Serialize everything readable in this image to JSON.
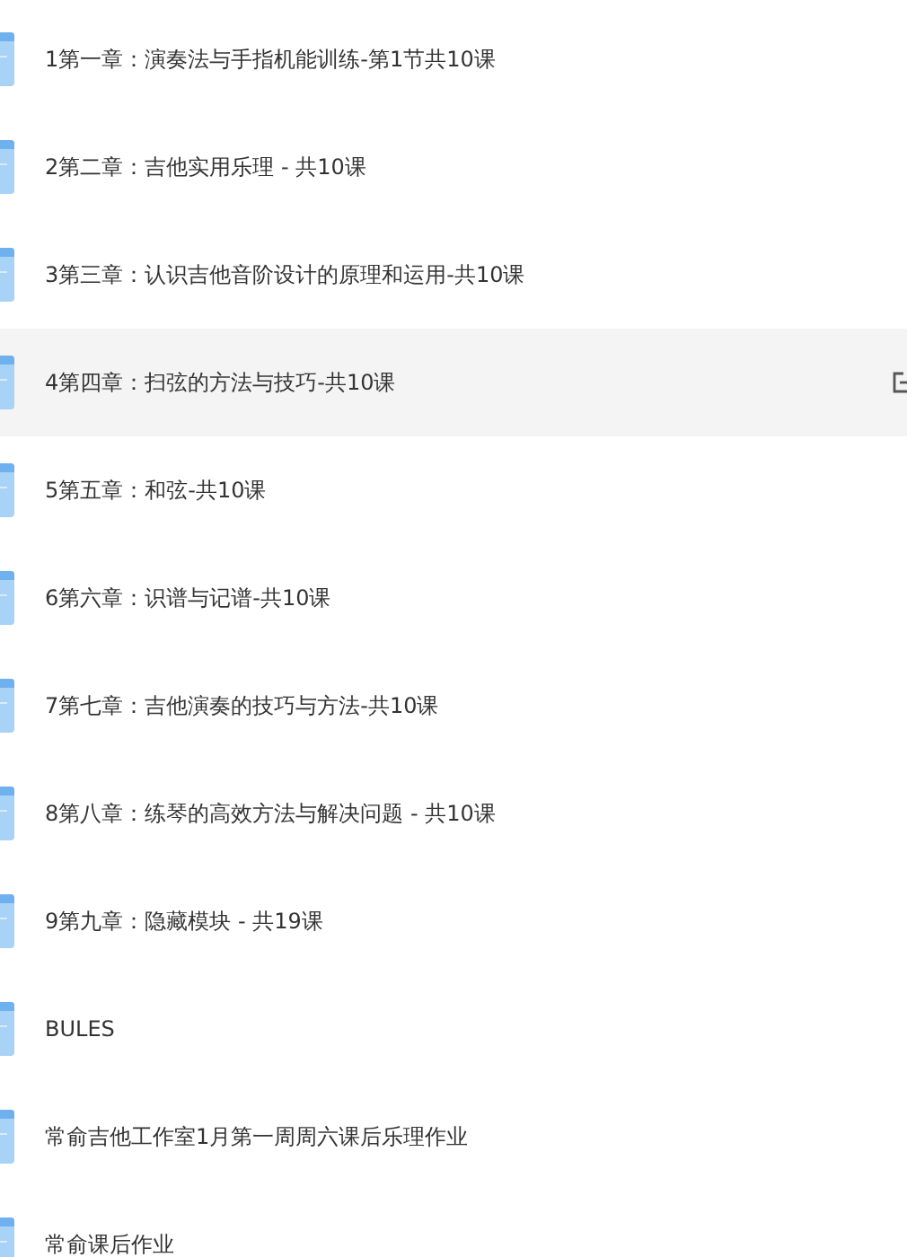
{
  "files": [
    {
      "name": "1第一章：演奏法与手指机能训练-第1节共10课",
      "highlighted": false
    },
    {
      "name": "2第二章：吉他实用乐理 - 共10课",
      "highlighted": false
    },
    {
      "name": "3第三章：认识吉他音阶设计的原理和运用-共10课",
      "highlighted": false
    },
    {
      "name": "4第四章：扫弦的方法与技巧-共10课",
      "highlighted": true
    },
    {
      "name": "5第五章：和弦-共10课",
      "highlighted": false
    },
    {
      "name": "6第六章：识谱与记谱-共10课",
      "highlighted": false
    },
    {
      "name": "7第七章：吉他演奏的技巧与方法-共10课",
      "highlighted": false
    },
    {
      "name": "8第八章：练琴的高效方法与解决问题 - 共10课",
      "highlighted": false
    },
    {
      "name": "9第九章：隐藏模块 - 共19课",
      "highlighted": false
    },
    {
      "name": "BULES",
      "highlighted": false
    },
    {
      "name": "常俞吉他工作室1月第一周周六课后乐理作业",
      "highlighted": false
    },
    {
      "name": "常俞课后作业",
      "highlighted": false
    }
  ]
}
